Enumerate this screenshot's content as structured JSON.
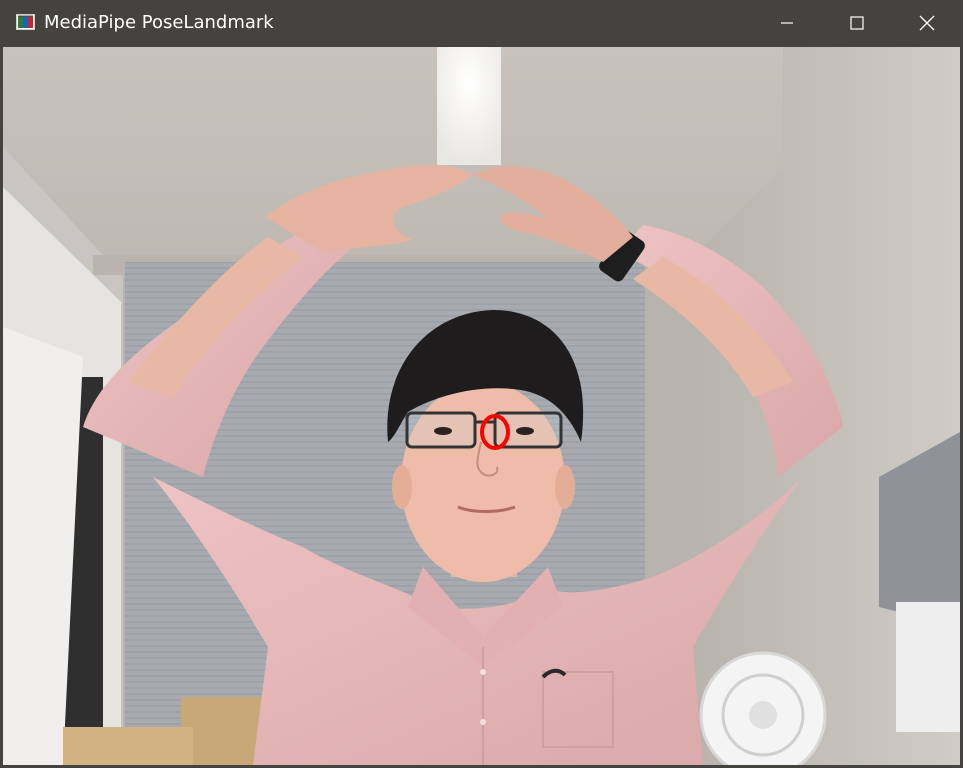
{
  "window": {
    "title": "MediaPipe PoseLandmark",
    "icons": {
      "app": "opencv-window-icon",
      "minimize": "minimize-icon",
      "maximize": "maximize-icon",
      "close": "close-icon"
    }
  },
  "colors": {
    "titlebar": "#45433f",
    "title_text": "#ffffff",
    "landmark_marker": "#ff0000",
    "shirt": "#e8b9b9",
    "ceiling": "#c9c5be",
    "blinds": "#a9adb2"
  },
  "video_frame": {
    "landmark_marker_shape": "red-ellipse-on-nose"
  }
}
